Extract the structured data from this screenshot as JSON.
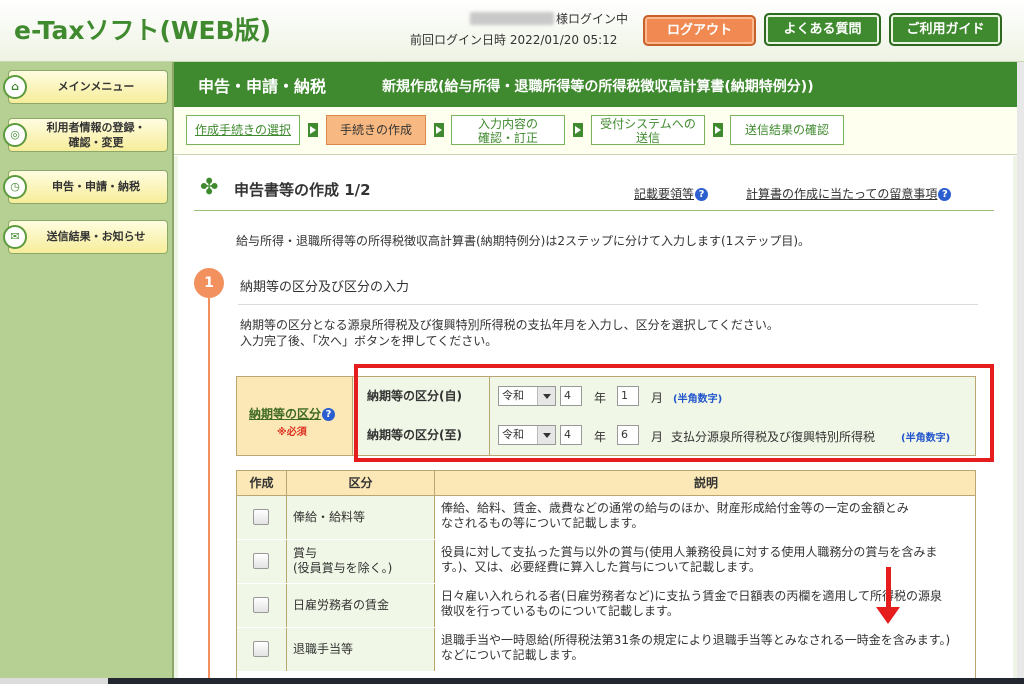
{
  "app": {
    "logo": "e-Taxソフト(WEB版)",
    "user_suffix": "様ログイン中",
    "last_login_label": "前回ログイン日時",
    "last_login_value": "2022/01/20 05:12",
    "logout_label": "ログアウト",
    "faq_label": "よくある質問",
    "guide_label": "ご利用ガイド"
  },
  "sidebar": {
    "items": [
      {
        "label": "メインメニュー",
        "icon": "home-icon"
      },
      {
        "label_line1": "利用者情報の登録・",
        "label_line2": "確認・変更",
        "icon": "user-info-icon"
      },
      {
        "label": "申告・申請・納税",
        "icon": "declaration-icon"
      },
      {
        "label": "送信結果・お知らせ",
        "icon": "notice-icon"
      }
    ]
  },
  "title_bar": {
    "main": "申告・申請・納税",
    "sub": "新規作成(給与所得・退職所得等の所得税徴収高計算書(納期特例分))"
  },
  "steps": [
    {
      "label": "作成手続きの選択"
    },
    {
      "label": "手続きの作成"
    },
    {
      "label_line1": "入力内容の",
      "label_line2": "確認・訂正"
    },
    {
      "label_line1": "受付システムへの",
      "label_line2": "送信"
    },
    {
      "label": "送信結果の確認"
    }
  ],
  "section": {
    "title": "申告書等の作成 1/2",
    "link1": "記載要領等",
    "link2": "計算書の作成に当たっての留意事項",
    "help_glyph": "?",
    "intro": "給与所得・退職所得等の所得税徴収高計算書(納期特例分)は2ステップに分けて入力します(1ステップ目)。"
  },
  "step1": {
    "number": "1",
    "title": "納期等の区分及び区分の入力",
    "desc_line1": "納期等の区分となる源泉所得税及び復興特別所得税の支払年月を入力し、区分を選択してください。",
    "desc_line2": "入力完了後、「次へ」ボタンを押してください。"
  },
  "period": {
    "label": "納期等の区分",
    "required": "※必須",
    "rows": [
      {
        "label": "納期等の区分(自)",
        "era": "令和",
        "year": "4",
        "year_unit": "年",
        "month": "1",
        "month_unit": "月",
        "note": "",
        "hint": "(半角数字)"
      },
      {
        "label": "納期等の区分(至)",
        "era": "令和",
        "year": "4",
        "year_unit": "年",
        "month": "6",
        "month_unit": "月",
        "note": "支払分源泉所得税及び復興特別所得税",
        "hint": "(半角数字)"
      }
    ]
  },
  "categories": {
    "headers": {
      "create": "作成",
      "category": "区分",
      "description": "説明"
    },
    "rows": [
      {
        "name": "俸給・給料等",
        "desc_line1": "俸給、給料、賃金、歳費などの通常の給与のほか、財産形成給付金等の一定の金額とみ",
        "desc_line2": "なされるもの等について記載します。"
      },
      {
        "name_line1": "賞与",
        "name_line2": "(役員賞与を除く。)",
        "desc_line1": "役員に対して支払った賞与以外の賞与(使用人兼務役員に対する使用人職務分の賞与を含みま",
        "desc_line2": "す。)、又は、必要経費に算入した賞与について記載します。"
      },
      {
        "name": "日雇労務者の賃金",
        "desc_line1": "日々雇い入れられる者(日雇労務者など)に支払う賃金で日額表の丙欄を適用して所得税の源泉",
        "desc_line2": "徴収を行っているものについて記載します。"
      },
      {
        "name": "退職手当等",
        "desc_line1": "退職手当や一時恩給(所得税法第31条の規定により退職手当等とみなされる一時金を含みます。)",
        "desc_line2": "などについて記載します。"
      }
    ]
  },
  "colors": {
    "brand_green": "#3f8a2e",
    "logout_orange": "#f08a52",
    "highlight_red": "#e51d1d",
    "active_step": "#f7b981"
  }
}
